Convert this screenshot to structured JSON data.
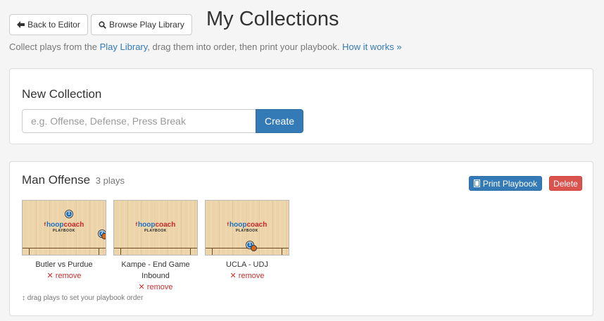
{
  "toolbar": {
    "back_label": "Back to Editor",
    "browse_label": "Browse Play Library"
  },
  "page": {
    "title": "My Collections",
    "intro_prefix": "Collect plays from the ",
    "intro_link": "Play Library",
    "intro_middle": ", drag them into order, then print your playbook. ",
    "how_link": "How it works »"
  },
  "new_collection": {
    "title": "New Collection",
    "placeholder": "e.g. Offense, Defense, Press Break",
    "value": "",
    "create_label": "Create"
  },
  "collection": {
    "name": "Man Offense",
    "count": "3 plays",
    "print_label": "Print Playbook",
    "delete_label": "Delete",
    "hint": "↕ drag plays to set your playbook order",
    "thumbnail_logo": {
      "f": "f",
      "hoop": "hoop",
      "coach": "coach",
      "sub": "PLAYBOOK"
    },
    "plays": [
      {
        "name": "Butler vs Purdue",
        "remove_label": "✕ remove"
      },
      {
        "name": "Kampe - End Game Inbound",
        "remove_label": "✕ remove"
      },
      {
        "name": "UCLA - UDJ",
        "remove_label": "✕ remove"
      }
    ]
  },
  "colors": {
    "primary": "#337ab7",
    "danger": "#d9534f",
    "remove": "#c9302c",
    "court": "#ecd3a8"
  },
  "icons": {
    "back": "arrow-left-icon",
    "browse": "search-icon",
    "print": "book-icon",
    "drag": "updown-arrow-icon"
  }
}
